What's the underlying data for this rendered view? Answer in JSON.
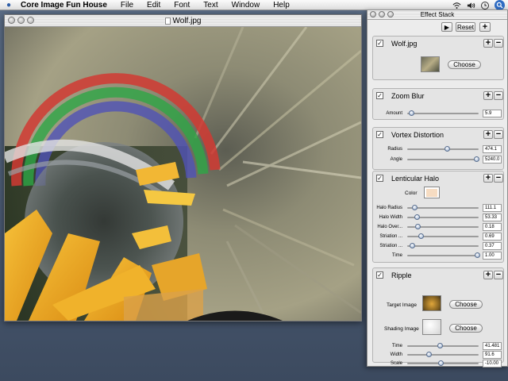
{
  "menubar": {
    "apple_icon": "apple-logo-icon",
    "app_name": "Core Image Fun House",
    "items": [
      "File",
      "Edit",
      "Font",
      "Text",
      "Window",
      "Help"
    ],
    "status_icons": [
      "wifi-icon",
      "volume-icon",
      "clock-icon",
      "spotlight-icon"
    ]
  },
  "document": {
    "title": "Wolf.jpg"
  },
  "effect_stack": {
    "title": "Effect Stack",
    "reset_label": "Reset",
    "play_glyph": "▶",
    "plus_glyph": "+",
    "minus_glyph": "−",
    "check_glyph": "✓",
    "choose_label": "Choose",
    "accent_color": "#5a6f8f",
    "effects": [
      {
        "title": "Wolf.jpg",
        "enabled": true
      },
      {
        "title": "Zoom Blur",
        "enabled": true,
        "params": [
          {
            "label": "Amount",
            "value": "5.9",
            "level": 0.06
          }
        ]
      },
      {
        "title": "Vortex Distortion",
        "enabled": true,
        "params": [
          {
            "label": "Radius",
            "value": "474.1",
            "level": 0.56
          },
          {
            "label": "Angle",
            "value": "5240.0",
            "level": 0.97
          }
        ]
      },
      {
        "title": "Lenticular Halo",
        "enabled": true,
        "color_label": "Color",
        "color_value": "#f6dcc2",
        "params": [
          {
            "label": "Halo Radius",
            "value": "111.1",
            "level": 0.1
          },
          {
            "label": "Halo Width",
            "value": "53.33",
            "level": 0.13
          },
          {
            "label": "Halo Over...",
            "value": "0.18",
            "level": 0.14
          },
          {
            "label": "Striation ...",
            "value": "0.69",
            "level": 0.19
          },
          {
            "label": "Striation ...",
            "value": "0.37",
            "level": 0.07
          },
          {
            "label": "Time",
            "value": "1.00",
            "level": 0.98
          }
        ]
      },
      {
        "title": "Ripple",
        "enabled": true,
        "target_label": "Target Image",
        "shading_label": "Shading Image",
        "params": [
          {
            "label": "Time",
            "value": "41.481",
            "level": 0.46
          },
          {
            "label": "Width",
            "value": "91.6",
            "level": 0.3
          },
          {
            "label": "Scale",
            "value": "-10.00",
            "level": 0.47
          }
        ]
      }
    ]
  }
}
